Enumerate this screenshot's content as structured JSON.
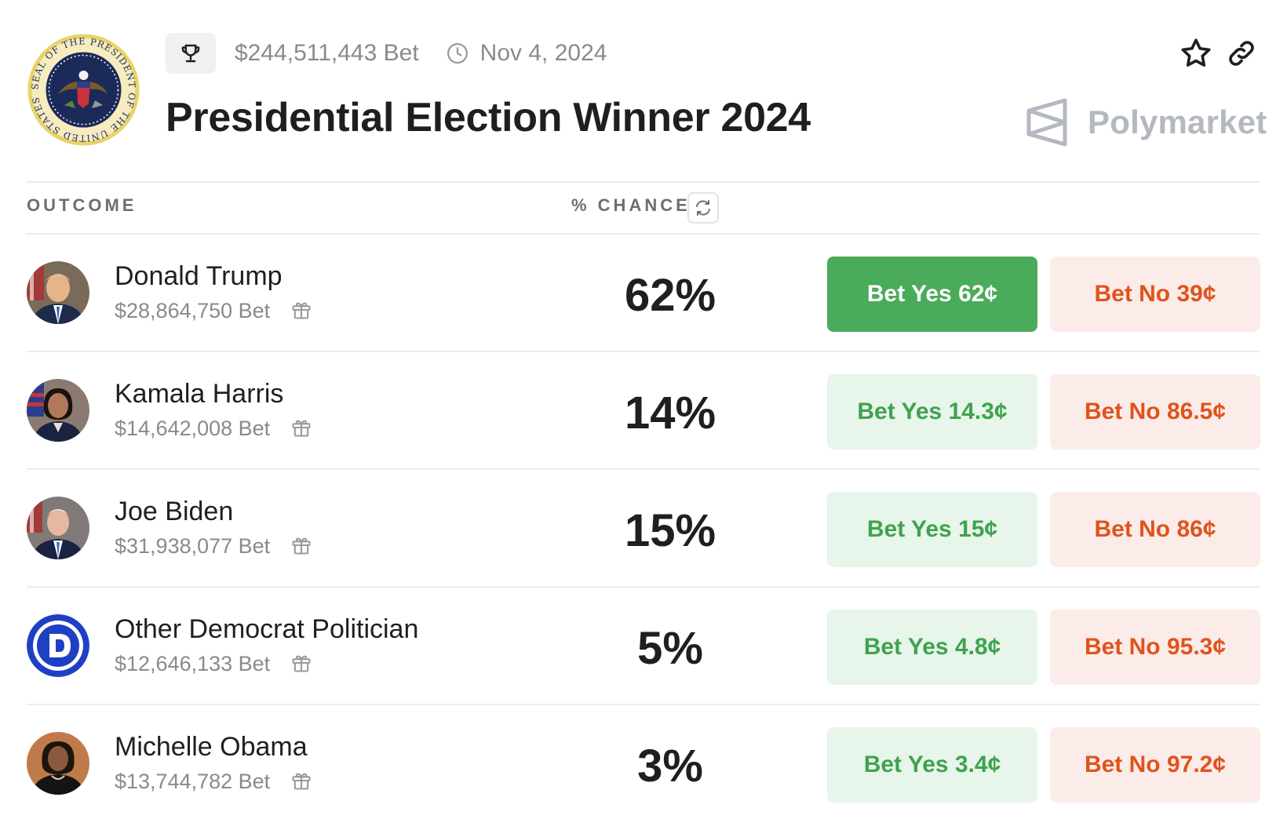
{
  "header": {
    "volume": "$244,511,443 Bet",
    "date": "Nov 4, 2024",
    "title": "Presidential Election Winner 2024",
    "brand": "Polymarket"
  },
  "columns": {
    "outcome": "OUTCOME",
    "chance": "% CHANCE"
  },
  "outcomes": [
    {
      "name": "Donald Trump",
      "volume": "$28,864,750 Bet",
      "chance": "62%",
      "yes": "Bet Yes 62¢",
      "no": "Bet No 39¢"
    },
    {
      "name": "Kamala Harris",
      "volume": "$14,642,008 Bet",
      "chance": "14%",
      "yes": "Bet Yes 14.3¢",
      "no": "Bet No 86.5¢"
    },
    {
      "name": "Joe Biden",
      "volume": "$31,938,077 Bet",
      "chance": "15%",
      "yes": "Bet Yes 15¢",
      "no": "Bet No 86¢"
    },
    {
      "name": "Other Democrat Politician",
      "volume": "$12,646,133 Bet",
      "chance": "5%",
      "yes": "Bet Yes 4.8¢",
      "no": "Bet No 95.3¢"
    },
    {
      "name": "Michelle Obama",
      "volume": "$13,744,782 Bet",
      "chance": "3%",
      "yes": "Bet Yes 3.4¢",
      "no": "Bet No 97.2¢"
    }
  ],
  "seal_text": "SEAL OF THE PRESIDENT OF THE UNITED STATES",
  "colors": {
    "yes_active_bg": "#4aab5b",
    "yes_bg": "#e7f5ea",
    "yes_text": "#3fa34d",
    "no_bg": "#fcece9",
    "no_text": "#e0531c",
    "democrat_blue": "#1f3fc4"
  },
  "icons": [
    "trophy-icon",
    "clock-icon",
    "star-icon",
    "link-icon",
    "polymarket-logo-icon",
    "refresh-icon",
    "gift-icon"
  ]
}
